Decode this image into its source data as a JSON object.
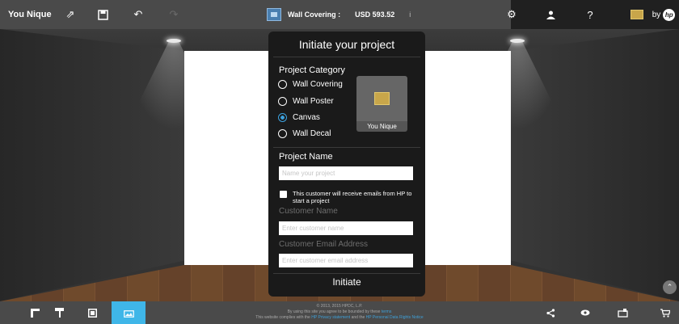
{
  "topbar": {
    "brand": "You Nique",
    "icons": [
      "expand-icon",
      "save-icon",
      "undo-icon",
      "redo-icon"
    ],
    "product_label": "Wall Covering :",
    "price": "USD 593.52",
    "info": "i",
    "right_icons": [
      "settings-icon",
      "support-icon",
      "help-icon"
    ],
    "help_glyph": "?",
    "by_label": "by",
    "hp_logo_text": "hp"
  },
  "modal": {
    "title": "Initiate your project",
    "category_label": "Project Category",
    "categories": [
      {
        "label": "Wall Covering",
        "selected": false
      },
      {
        "label": "Wall Poster",
        "selected": false
      },
      {
        "label": "Canvas",
        "selected": true
      },
      {
        "label": "Wall Decal",
        "selected": false
      }
    ],
    "preview_caption": "You Nique",
    "project_name_label": "Project Name",
    "project_name_placeholder": "Name your project",
    "email_consent": "This customer will receive emails from HP to start a project",
    "customer_name_label": "Customer Name",
    "customer_name_placeholder": "Enter customer name",
    "customer_email_label": "Customer Email Address",
    "customer_email_placeholder": "Enter customer email address",
    "submit_label": "Initiate"
  },
  "bottombar": {
    "left_icons": [
      "wall-tool-icon",
      "paint-roller-icon",
      "frame-icon",
      "image-gallery-icon"
    ],
    "active_icon": "image-gallery-icon",
    "legal_line1": "© 2013, 2015 HPDC, L.P.",
    "legal_line2_pre": "By using this site you agree to be bounded by these",
    "legal_line2_link": "terms",
    "legal_line3_pre": "This website complies with the",
    "legal_line3_link1": "HP Privacy statement",
    "legal_line3_mid": "and the",
    "legal_line3_link2": "HP Personal Data Rights Notice",
    "right_icons": [
      "share-icon",
      "view-icon",
      "cart-add-icon",
      "cart-icon"
    ]
  },
  "colors": {
    "accent": "#3fb6e8",
    "radio_selected": "#3da3e0",
    "floor": "#6f4a2c"
  }
}
